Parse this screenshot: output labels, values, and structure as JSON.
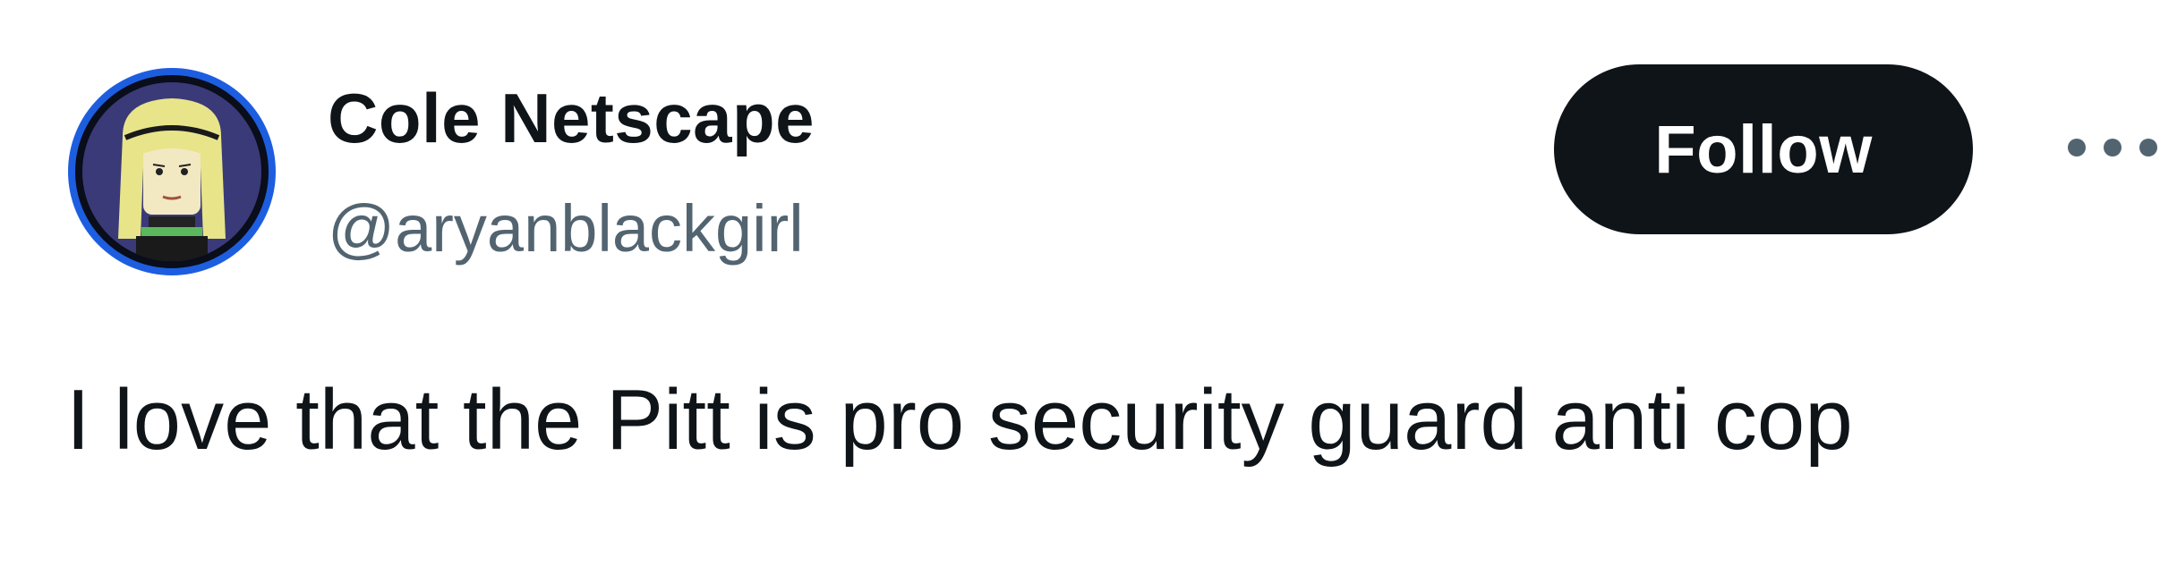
{
  "user": {
    "display_name": "Cole Netscape",
    "handle": "@aryanblackgirl"
  },
  "actions": {
    "follow_label": "Follow",
    "more_icon": "more-horizontal-icon"
  },
  "tweet": {
    "text": "I love that the Pitt is pro security guard anti cop"
  },
  "colors": {
    "text_primary": "#0f1419",
    "text_secondary": "#536471",
    "follow_bg": "#0f1419",
    "follow_text": "#ffffff",
    "avatar_ring": "#1d5ee0"
  }
}
